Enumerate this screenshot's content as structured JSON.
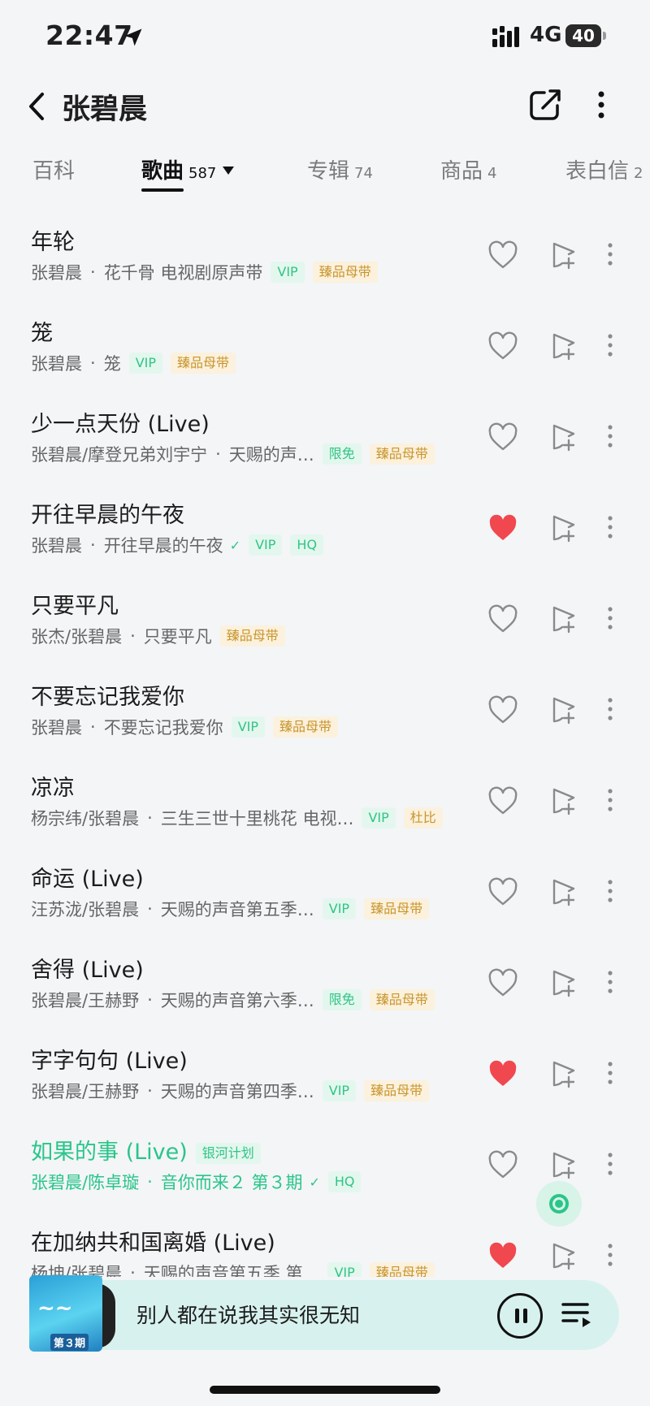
{
  "status_bar": {
    "time": "22:47",
    "network": "4G",
    "battery": "40"
  },
  "header": {
    "title": "张碧晨"
  },
  "tabs": [
    {
      "label": "百科",
      "count": ""
    },
    {
      "label": "歌曲",
      "count": "587"
    },
    {
      "label": "专辑",
      "count": "74"
    },
    {
      "label": "商品",
      "count": "4"
    },
    {
      "label": "表白信",
      "count": "2"
    }
  ],
  "songs": [
    {
      "title": "年轮",
      "artist": "张碧晨",
      "album": "花千骨 电视剧原声带",
      "badges": [
        "VIP",
        "臻品母带"
      ],
      "liked": false
    },
    {
      "title": "笼",
      "artist": "张碧晨",
      "album": "笼",
      "badges": [
        "VIP",
        "臻品母带"
      ],
      "liked": false
    },
    {
      "title": "少一点天份 (Live)",
      "artist": "张碧晨/摩登兄弟刘宇宁",
      "album": "天赐的声…",
      "badges": [
        "限免",
        "臻品母带"
      ],
      "liked": false
    },
    {
      "title": "开往早晨的午夜",
      "artist": "张碧晨",
      "album": "开往早晨的午夜",
      "badges": [
        "VIP",
        "HQ"
      ],
      "liked": true,
      "downloaded": true
    },
    {
      "title": "只要平凡",
      "artist": "张杰/张碧晨",
      "album": "只要平凡",
      "badges": [
        "臻品母带"
      ],
      "liked": false
    },
    {
      "title": "不要忘记我爱你",
      "artist": "张碧晨",
      "album": "不要忘记我爱你",
      "badges": [
        "VIP",
        "臻品母带"
      ],
      "liked": false
    },
    {
      "title": "凉凉",
      "artist": "杨宗纬/张碧晨",
      "album": "三生三世十里桃花 电视…",
      "badges": [
        "VIP",
        "杜比"
      ],
      "liked": false
    },
    {
      "title": "命运 (Live)",
      "artist": "汪苏泷/张碧晨",
      "album": "天赐的声音第五季…",
      "badges": [
        "VIP",
        "臻品母带"
      ],
      "liked": false
    },
    {
      "title": "舍得 (Live)",
      "artist": "张碧晨/王赫野",
      "album": "天赐的声音第六季…",
      "badges": [
        "限免",
        "臻品母带"
      ],
      "liked": false
    },
    {
      "title": "字字句句 (Live)",
      "artist": "张碧晨/王赫野",
      "album": "天赐的声音第四季…",
      "badges": [
        "VIP",
        "臻品母带"
      ],
      "liked": true
    },
    {
      "title": "如果的事 (Live)",
      "title_badge": "银河计划",
      "artist": "张碧晨/陈卓璇",
      "album": "音你而来２ 第３期",
      "badges": [
        "HQ"
      ],
      "liked": false,
      "downloaded": true,
      "playing": true
    },
    {
      "title": "在加纳共和国离婚 (Live)",
      "artist": "杨坤/张碧晨",
      "album": "天赐的声音第五季 第…",
      "badges": [
        "VIP",
        "臻品母带"
      ],
      "liked": true
    }
  ],
  "now_playing": {
    "title": "别人都在说我其实很无知",
    "cover_label": "第３期"
  },
  "colors": {
    "accent": "#2ac58a",
    "heart": "#f0484e",
    "gold": "#c9952c"
  }
}
